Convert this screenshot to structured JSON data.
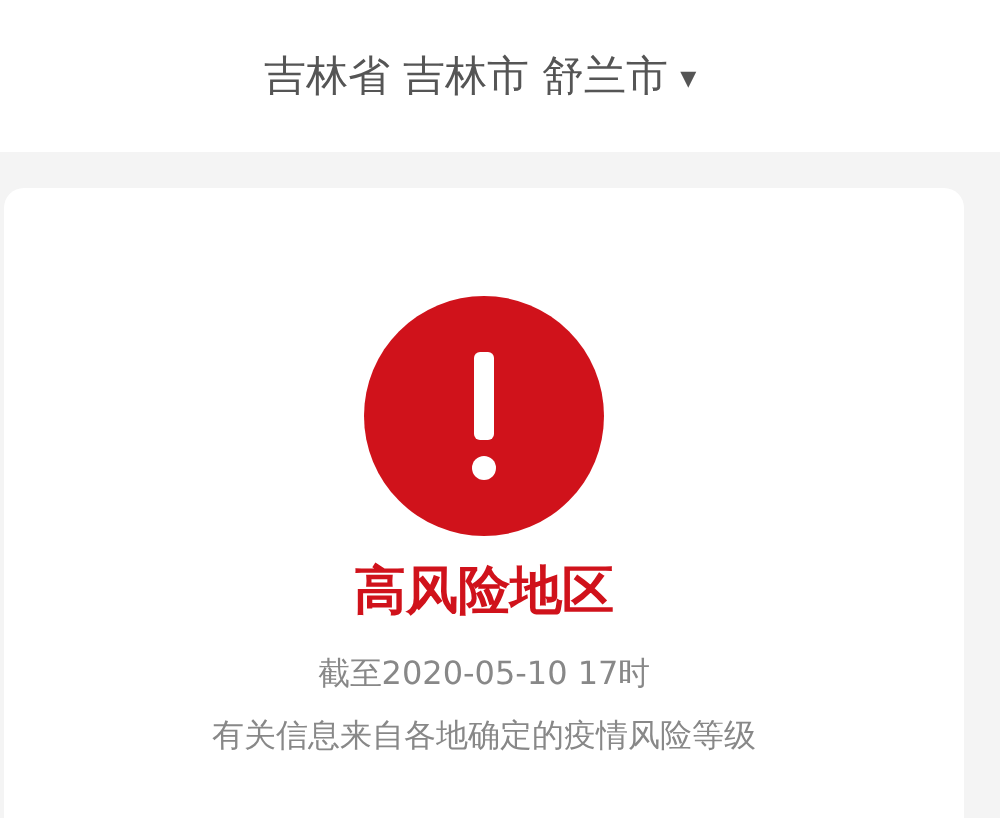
{
  "location": {
    "label": "吉林省 吉林市 舒兰市",
    "caret": "▾"
  },
  "risk": {
    "color": "#d0121b",
    "title": "高风险地区",
    "as_of": "截至2020-05-10 17时",
    "note": "有关信息来自各地确定的疫情风险等级"
  }
}
